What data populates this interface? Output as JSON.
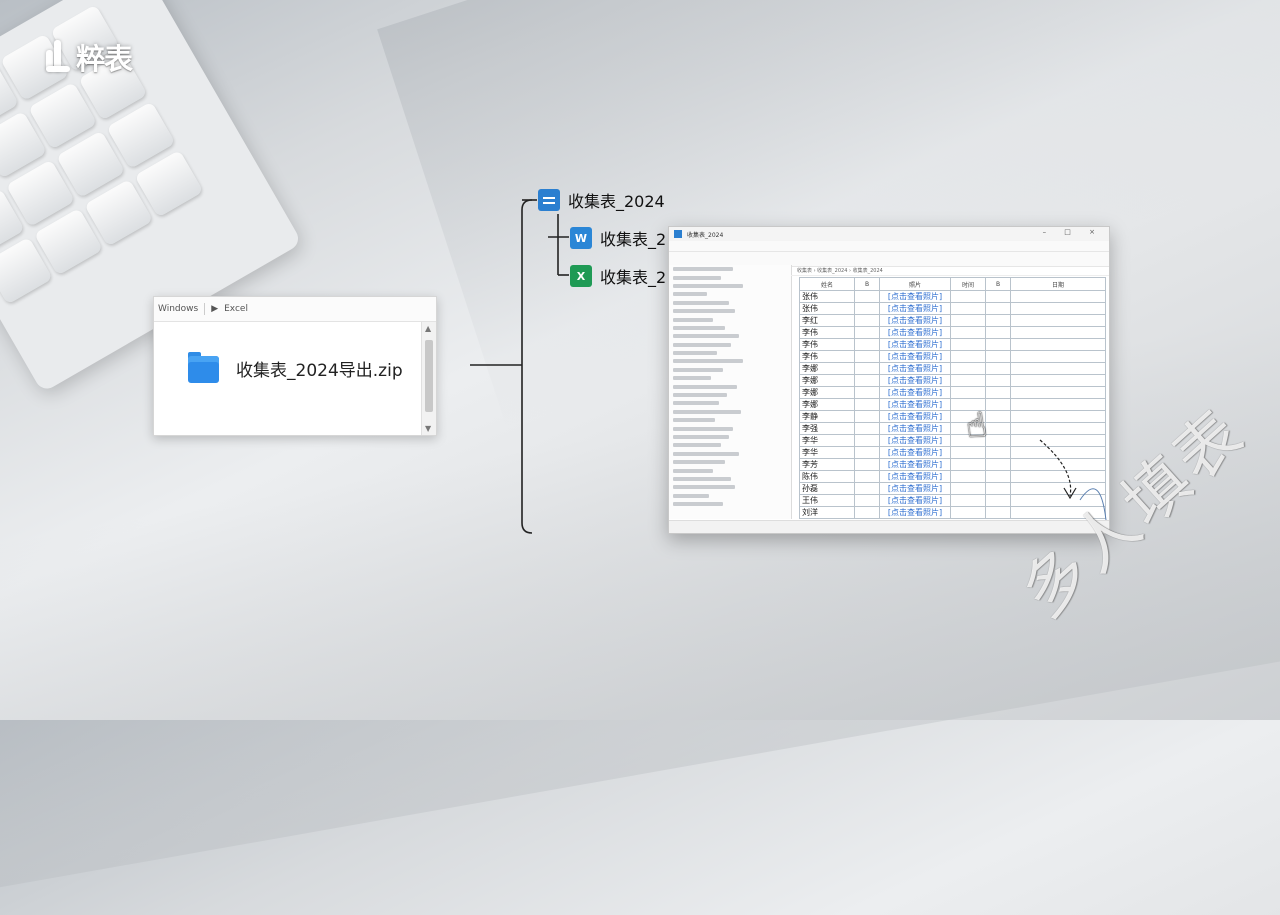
{
  "logo": {
    "text": "粹表"
  },
  "explorer": {
    "toolbar": [
      "Windows",
      "Excel"
    ],
    "file_name": "收集表_2024导出.zip",
    "scroll_up": "▲",
    "scroll_down": "▼"
  },
  "tree": {
    "root": "收集表_2024",
    "children": [
      {
        "label": "收集表_2",
        "icon": "word-icon",
        "glyph": "W"
      },
      {
        "label": "收集表_2",
        "icon": "excel-icon",
        "glyph": "X"
      }
    ]
  },
  "spreadsheet": {
    "title": "收集表_2024",
    "window_controls": "– □ ×",
    "path": "收集表 › 收集表_2024 › 收集表_2024",
    "headers": [
      "姓名",
      "B",
      "照片",
      "时间",
      "B",
      "日期"
    ],
    "rows": [
      {
        "name": "张伟",
        "link": "[点击查看照片]"
      },
      {
        "name": "张伟",
        "link": "[点击查看照片]"
      },
      {
        "name": "李红",
        "link": "[点击查看照片]"
      },
      {
        "name": "李伟",
        "link": "[点击查看照片]"
      },
      {
        "name": "李伟",
        "link": "[点击查看照片]"
      },
      {
        "name": "李伟",
        "link": "[点击查看照片]"
      },
      {
        "name": "李娜",
        "link": "[点击查看照片]"
      },
      {
        "name": "李娜",
        "link": "[点击查看照片]"
      },
      {
        "name": "李娜",
        "link": "[点击查看照片]"
      },
      {
        "name": "李娜",
        "link": "[点击查看照片]"
      },
      {
        "name": "李静",
        "link": "[点击查看照片]"
      },
      {
        "name": "李强",
        "link": "[点击查看照片]"
      },
      {
        "name": "李华",
        "link": "[点击查看照片]"
      },
      {
        "name": "李华",
        "link": "[点击查看照片]"
      },
      {
        "name": "李芳",
        "link": "[点击查看照片]"
      },
      {
        "name": "陈伟",
        "link": "[点击查看照片]"
      },
      {
        "name": "孙磊",
        "link": "[点击查看照片]"
      },
      {
        "name": "王伟",
        "link": "[点击查看照片]"
      },
      {
        "name": "刘洋",
        "link": "[点击查看照片]"
      }
    ]
  },
  "watermark": "多人填表",
  "colors": {
    "link": "#2f6fd1",
    "folder": "#2e8cea",
    "excel": "#1f9a55",
    "word": "#2a86d6"
  }
}
